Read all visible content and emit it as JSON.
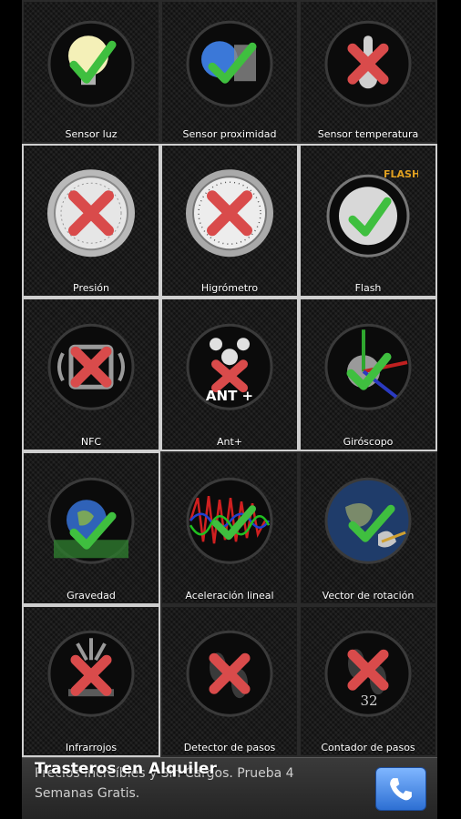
{
  "tiles": [
    {
      "label": "Sensor luz",
      "icon": "light-bulb-icon",
      "status": "available"
    },
    {
      "label": "Sensor proximidad",
      "icon": "proximity-sphere-icon",
      "status": "available"
    },
    {
      "label": "Sensor temperatura",
      "icon": "thermometer-icon",
      "status": "unavailable"
    },
    {
      "label": "Presión",
      "icon": "barometer-icon",
      "status": "unavailable"
    },
    {
      "label": "Higrómetro",
      "icon": "hygrometer-icon",
      "status": "unavailable"
    },
    {
      "label": "Flash",
      "icon": "flash-icon",
      "status": "available"
    },
    {
      "label": "NFC",
      "icon": "nfc-icon",
      "status": "unavailable"
    },
    {
      "label": "Ant+",
      "icon": "ant-plus-icon",
      "status": "unavailable"
    },
    {
      "label": "Giróscopo",
      "icon": "gyroscope-icon",
      "status": "available"
    },
    {
      "label": "Gravedad",
      "icon": "gravity-earth-icon",
      "status": "available"
    },
    {
      "label": "Aceleración lineal",
      "icon": "linear-acceleration-icon",
      "status": "available"
    },
    {
      "label": "Vector de rotación",
      "icon": "rotation-vector-icon",
      "status": "available"
    },
    {
      "label": "Infrarrojos",
      "icon": "infrared-icon",
      "status": "unavailable"
    },
    {
      "label": "Detector de pasos",
      "icon": "step-detector-icon",
      "status": "unavailable"
    },
    {
      "label": "Contador de pasos",
      "icon": "step-counter-icon",
      "status": "unavailable"
    }
  ],
  "icon_texts": {
    "flash": "FLASH",
    "ant": "ANT +",
    "step_count": "32"
  },
  "ad": {
    "title": "Trasteros en Alquiler",
    "subtitle": "Precios Increíbles y Sin Cargos. Prueba 4 Semanas Gratis.",
    "call_icon": "phone-icon"
  },
  "colors": {
    "check": "#3fbf3f",
    "cross": "#d94b4b",
    "tile_bg": "#1a1a1a",
    "call_button": "#2d6fd3"
  }
}
